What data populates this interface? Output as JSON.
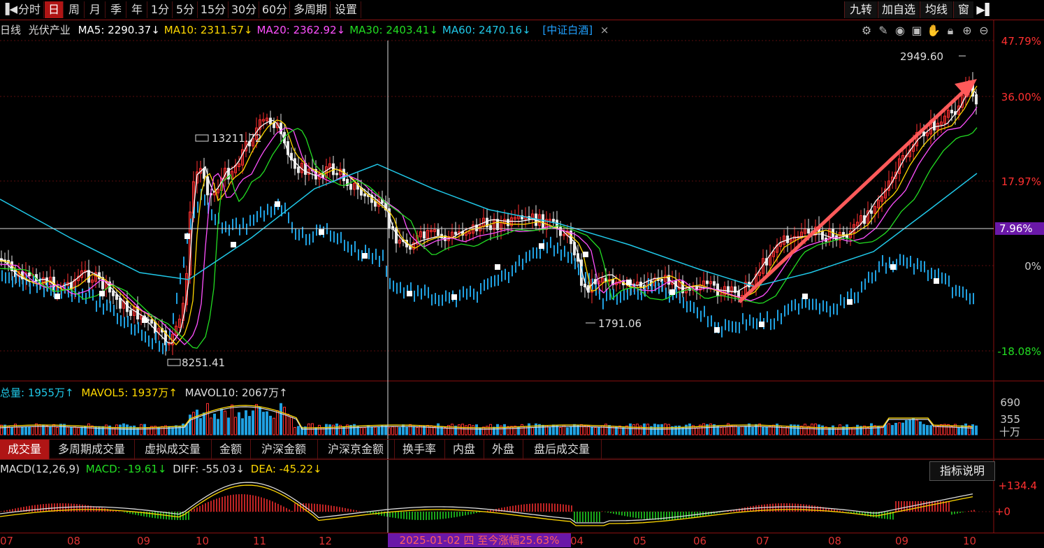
{
  "toolbar": {
    "periods": [
      "分时",
      "日",
      "周",
      "月",
      "季",
      "年",
      "1分",
      "5分",
      "15分",
      "30分",
      "60分",
      "多周期",
      "设置"
    ],
    "active_period": "日",
    "right_buttons": [
      "九转",
      "加自选",
      "均线",
      "窗"
    ]
  },
  "ma_line": {
    "period": "日线",
    "name": "光伏产业",
    "items": [
      {
        "label": "MA5: 2290.37↓",
        "color": "#ffffff"
      },
      {
        "label": "MA10: 2311.57↓",
        "color": "#ffd800"
      },
      {
        "label": "MA20: 2362.92↓",
        "color": "#ff50ff"
      },
      {
        "label": "MA30: 2403.41↓",
        "color": "#22dd22"
      },
      {
        "label": "MA60: 2470.16↓",
        "color": "#20c8e8"
      }
    ],
    "compare_tag": "[中证白酒]",
    "close_label": "×"
  },
  "tool_icons": [
    "gear-icon",
    "pen-icon",
    "eye-icon",
    "gift-icon",
    "hand-icon",
    "lock-icon",
    "zoom-in-icon",
    "zoom-out-icon"
  ],
  "main_axis": {
    "labels": [
      {
        "text": "47.79%",
        "color": "#ff3030"
      },
      {
        "text": "36.00%",
        "color": "#ff3030"
      },
      {
        "text": "17.97%",
        "color": "#ff3030"
      },
      {
        "text": "7.96%",
        "color": "#ffffff"
      },
      {
        "text": "0%",
        "color": "#cccccc"
      },
      {
        "text": "-18.08%",
        "color": "#22dd22"
      }
    ]
  },
  "annotations": {
    "high": "2949.60",
    "mid_high": "13211.72",
    "low1": "8251.41",
    "low2": "1791.06"
  },
  "volume": {
    "total_label": "总量: 1955万↑",
    "mavol5": "MAVOL5: 1937万↑",
    "mavol10": "MAVOL10: 2067万↑",
    "axis": [
      "690",
      "355",
      "十万"
    ]
  },
  "indicator_tabs": {
    "items": [
      "成交量",
      "多周期成交量",
      "虚拟成交量",
      "金额",
      "沪深金额",
      "沪深京金额",
      "换手率",
      "内盘",
      "外盘",
      "盘后成交量"
    ],
    "active": "成交量"
  },
  "macd": {
    "name": "MACD(12,26,9)",
    "macd": "MACD: -19.61↓",
    "diff": "DIFF: -55.03↓",
    "dea": "DEA: -45.22↓",
    "help_label": "指标说明",
    "axis": [
      "+134.4",
      "+0"
    ]
  },
  "xaxis": {
    "months": [
      "07",
      "08",
      "09",
      "10",
      "11",
      "12",
      "04",
      "05",
      "06",
      "07",
      "08",
      "09",
      "10"
    ],
    "date_badge": "2025-01-02 四 至今涨幅25.63%"
  },
  "colors": {
    "up": "#ff3030",
    "down": "#20a0e0",
    "ma5": "#ffffff",
    "ma10": "#ffd800",
    "ma20": "#ff50ff",
    "ma30": "#22dd22",
    "ma60": "#20c8e8",
    "arrow": "#ff5a5a"
  }
}
